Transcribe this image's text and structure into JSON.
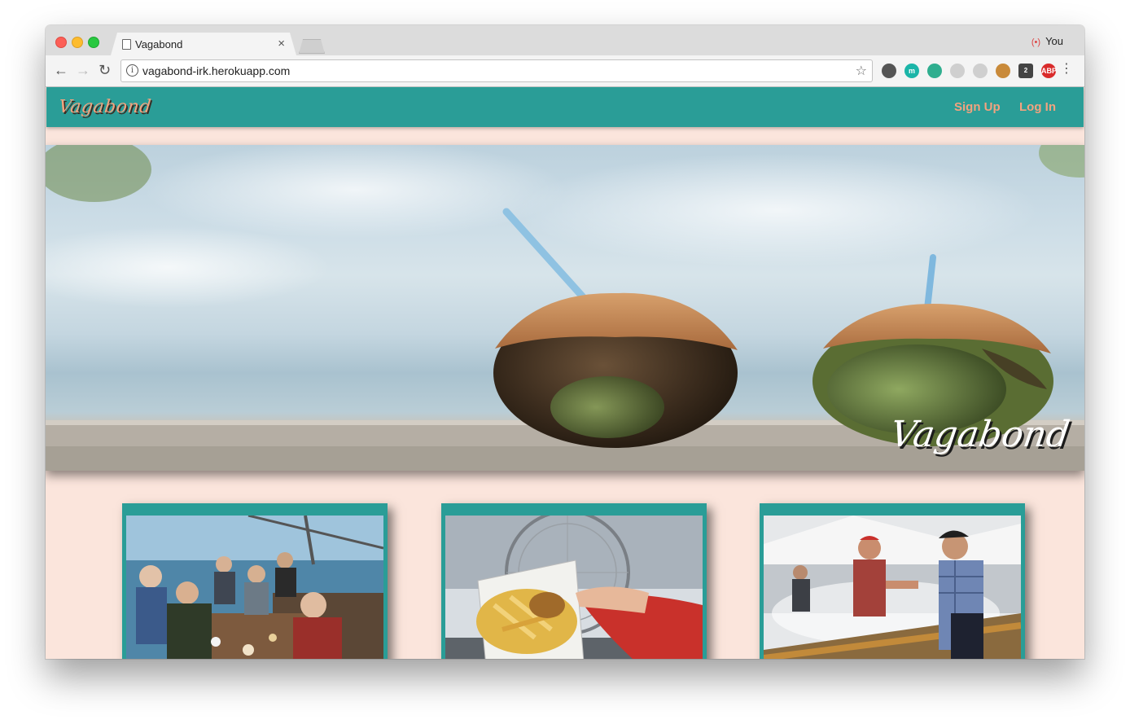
{
  "browser": {
    "tab_title": "Vagabond",
    "tab_close": "×",
    "profile_name": "You",
    "url": "vagabond-irk.herokuapp.com",
    "info_glyph": "i",
    "back_glyph": "←",
    "forward_glyph": "→",
    "reload_glyph": "↻",
    "star_glyph": "☆",
    "menu_glyph": "⋮",
    "extensions": [
      {
        "name": "evernote-icon",
        "label": "",
        "color": "#555555"
      },
      {
        "name": "m-extension-icon",
        "label": "m",
        "color": "#1bb5a8"
      },
      {
        "name": "mug-extension-icon",
        "label": "",
        "color": "#2fae8f"
      },
      {
        "name": "inactive-extension-icon",
        "label": "",
        "color": "#cfcfcf"
      },
      {
        "name": "inactive-extension-icon-2",
        "label": "",
        "color": "#cfcfcf"
      },
      {
        "name": "cookie-icon",
        "label": "",
        "color": "#c98a3a"
      },
      {
        "name": "badge-extension-icon",
        "label": "2",
        "color": "#444444"
      },
      {
        "name": "adblock-plus-icon",
        "label": "ABP",
        "color": "#d92b2b"
      }
    ]
  },
  "navbar": {
    "brand": "Vagabond",
    "links": [
      "Sign Up",
      "Log In"
    ]
  },
  "hero": {
    "overlay_title": "Vagabond"
  },
  "cards": [
    {
      "image": "group-dining-pier-photo"
    },
    {
      "image": "fish-and-chips-ferris-wheel-photo"
    },
    {
      "image": "grill-street-food-photo"
    }
  ],
  "colors": {
    "navbar": "#2a9d97",
    "accent": "#f3a37f",
    "page_background": "#fbe5dc",
    "card_border": "#2a9d97"
  }
}
